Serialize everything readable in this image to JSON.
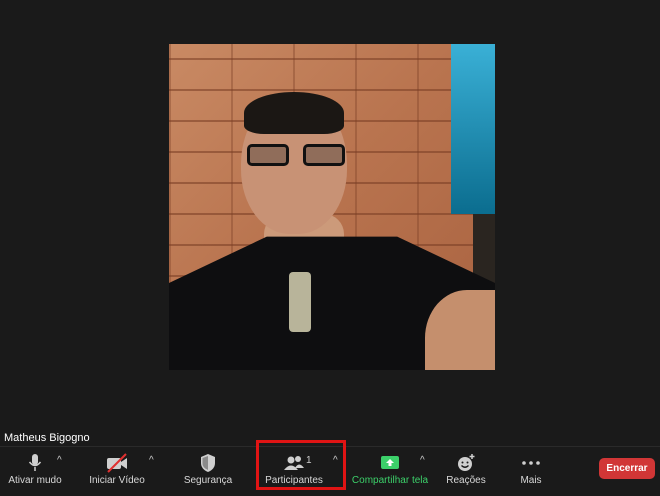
{
  "participant": {
    "name": "Matheus Bigogno"
  },
  "toolbar": {
    "mute_label": "Ativar mudo",
    "video_label": "Iniciar Vídeo",
    "security_label": "Segurança",
    "participants_label": "Participantes",
    "participants_count": "1",
    "share_label": "Compartilhar tela",
    "reactions_label": "Reações",
    "more_label": "Mais",
    "end_label": "Encerrar",
    "caret": "^"
  },
  "icons": {
    "mic": "microphone-icon",
    "video": "video-off-icon",
    "security": "shield-icon",
    "participants": "people-icon",
    "share": "share-screen-icon",
    "reactions": "emoji-add-icon",
    "more": "more-dots-icon"
  },
  "colors": {
    "background": "#1a1a1a",
    "share_green": "#3cd06a",
    "end_red": "#d13636",
    "highlight_red": "#e01414"
  }
}
